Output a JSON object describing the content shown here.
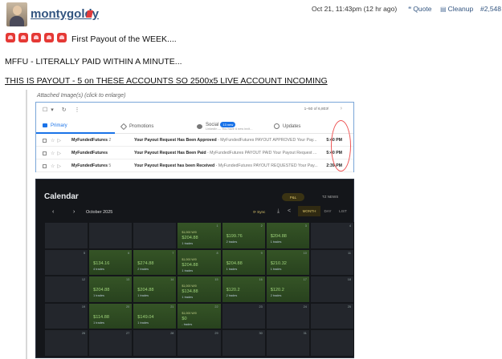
{
  "post": {
    "username": "montygoldy",
    "timestamp": "Oct 21, 11:43pm (12 hr ago)",
    "actions": {
      "quote": "Quote",
      "cleanup": "Cleanup",
      "post_number": "#2,548"
    },
    "line1": "First Payout of the WEEK....",
    "line2": "MFFU - LITERALLY PAID WITHIN A MINUTE...",
    "line3": "THIS IS PAYOUT - 5 on THESE ACCOUNTS SO 2500x5 LIVE ACCOUNT INCOMING",
    "attachment_label": "Attached Image(s) (click to enlarge)"
  },
  "inbox": {
    "range": "1–50 of 6,803",
    "tabs": {
      "primary": "Primary",
      "promotions": "Promotions",
      "social": "Social",
      "social_badge": "13 new",
      "social_sub": "LinkedIn — You have 6 new invit…",
      "updates": "Updates"
    },
    "rows": [
      {
        "sender": "MyFundedFutures",
        "count": "2",
        "subject_bold": "Your Payout Request Has Been Approved",
        "subject_rest": " - MyFundedFutures PAYOUT APPROVED Your Pay...",
        "time": "5:40 PM"
      },
      {
        "sender": "MyFundedFutures",
        "count": "",
        "subject_bold": "Your Payout Request Has Been Paid",
        "subject_rest": " - MyFundedFutures PAYOUT PAID Your Payout Request ...",
        "time": "5:40 PM"
      },
      {
        "sender": "MyFundedFutures",
        "count": "5",
        "subject_bold": "Your Payout Request has been Received",
        "subject_rest": " - MyFundedFutures PAYOUT REQUESTED Your Pay...",
        "time": "2:39 PM"
      }
    ]
  },
  "calendar": {
    "title": "Calendar",
    "pl": "P&L",
    "tz": "TZ NEWS",
    "month": "October 2025",
    "sync": "Sync",
    "views": [
      "MONTH",
      "DAY",
      "LIST"
    ],
    "cells": [
      {
        "day": "",
        "amount": "",
        "trades": "",
        "wr": ""
      },
      {
        "day": "",
        "amount": "",
        "trades": "",
        "wr": ""
      },
      {
        "day": "",
        "amount": "",
        "trades": "",
        "wr": ""
      },
      {
        "day": "1",
        "amount": "$204.88",
        "trades": "1 trades",
        "wr": "$1,000 W/0"
      },
      {
        "day": "2",
        "amount": "$199.76",
        "trades": "2 trades",
        "wr": ""
      },
      {
        "day": "3",
        "amount": "$204.88",
        "trades": "1 trades",
        "wr": ""
      },
      {
        "day": "4",
        "amount": "",
        "trades": "",
        "wr": ""
      },
      {
        "day": "5",
        "amount": "",
        "trades": "",
        "wr": ""
      },
      {
        "day": "6",
        "amount": "$134.16",
        "trades": "4 trades",
        "wr": ""
      },
      {
        "day": "7",
        "amount": "$274.88",
        "trades": "2 trades",
        "wr": ""
      },
      {
        "day": "8",
        "amount": "$204.88",
        "trades": "1 trades",
        "wr": "$1,000 W/0"
      },
      {
        "day": "9",
        "amount": "$204.88",
        "trades": "1 trades",
        "wr": ""
      },
      {
        "day": "10",
        "amount": "$210.32",
        "trades": "1 trades",
        "wr": ""
      },
      {
        "day": "11",
        "amount": "",
        "trades": "",
        "wr": ""
      },
      {
        "day": "12",
        "amount": "",
        "trades": "",
        "wr": ""
      },
      {
        "day": "13",
        "amount": "$204.88",
        "trades": "1 trades",
        "wr": ""
      },
      {
        "day": "14",
        "amount": "$204.88",
        "trades": "1 trades",
        "wr": ""
      },
      {
        "day": "15",
        "amount": "$134.88",
        "trades": "1 trades",
        "wr": "$1,000 W/0"
      },
      {
        "day": "16",
        "amount": "$120.2",
        "trades": "2 trades",
        "wr": ""
      },
      {
        "day": "17",
        "amount": "$120.2",
        "trades": "2 trades",
        "wr": ""
      },
      {
        "day": "18",
        "amount": "",
        "trades": "",
        "wr": ""
      },
      {
        "day": "19",
        "amount": "",
        "trades": "",
        "wr": ""
      },
      {
        "day": "20",
        "amount": "$114.88",
        "trades": "1 trades",
        "wr": ""
      },
      {
        "day": "21",
        "amount": "$149.04",
        "trades": "1 trades",
        "wr": ""
      },
      {
        "day": "22",
        "amount": "$0",
        "trades": "- trades",
        "wr": "$1,000 W/0"
      },
      {
        "day": "23",
        "amount": "",
        "trades": "",
        "wr": ""
      },
      {
        "day": "24",
        "amount": "",
        "trades": "",
        "wr": ""
      },
      {
        "day": "25",
        "amount": "",
        "trades": "",
        "wr": ""
      },
      {
        "day": "26",
        "amount": "",
        "trades": "",
        "wr": ""
      },
      {
        "day": "27",
        "amount": "",
        "trades": "",
        "wr": ""
      },
      {
        "day": "28",
        "amount": "",
        "trades": "",
        "wr": ""
      },
      {
        "day": "29",
        "amount": "",
        "trades": "",
        "wr": ""
      },
      {
        "day": "30",
        "amount": "",
        "trades": "",
        "wr": ""
      },
      {
        "day": "31",
        "amount": "",
        "trades": "",
        "wr": ""
      },
      {
        "day": "",
        "amount": "",
        "trades": "",
        "wr": ""
      }
    ]
  },
  "colors": {
    "link": "#335580",
    "gmail_blue": "#1a73e8",
    "profit": "#9ed27a",
    "gold": "#d9c36a"
  }
}
